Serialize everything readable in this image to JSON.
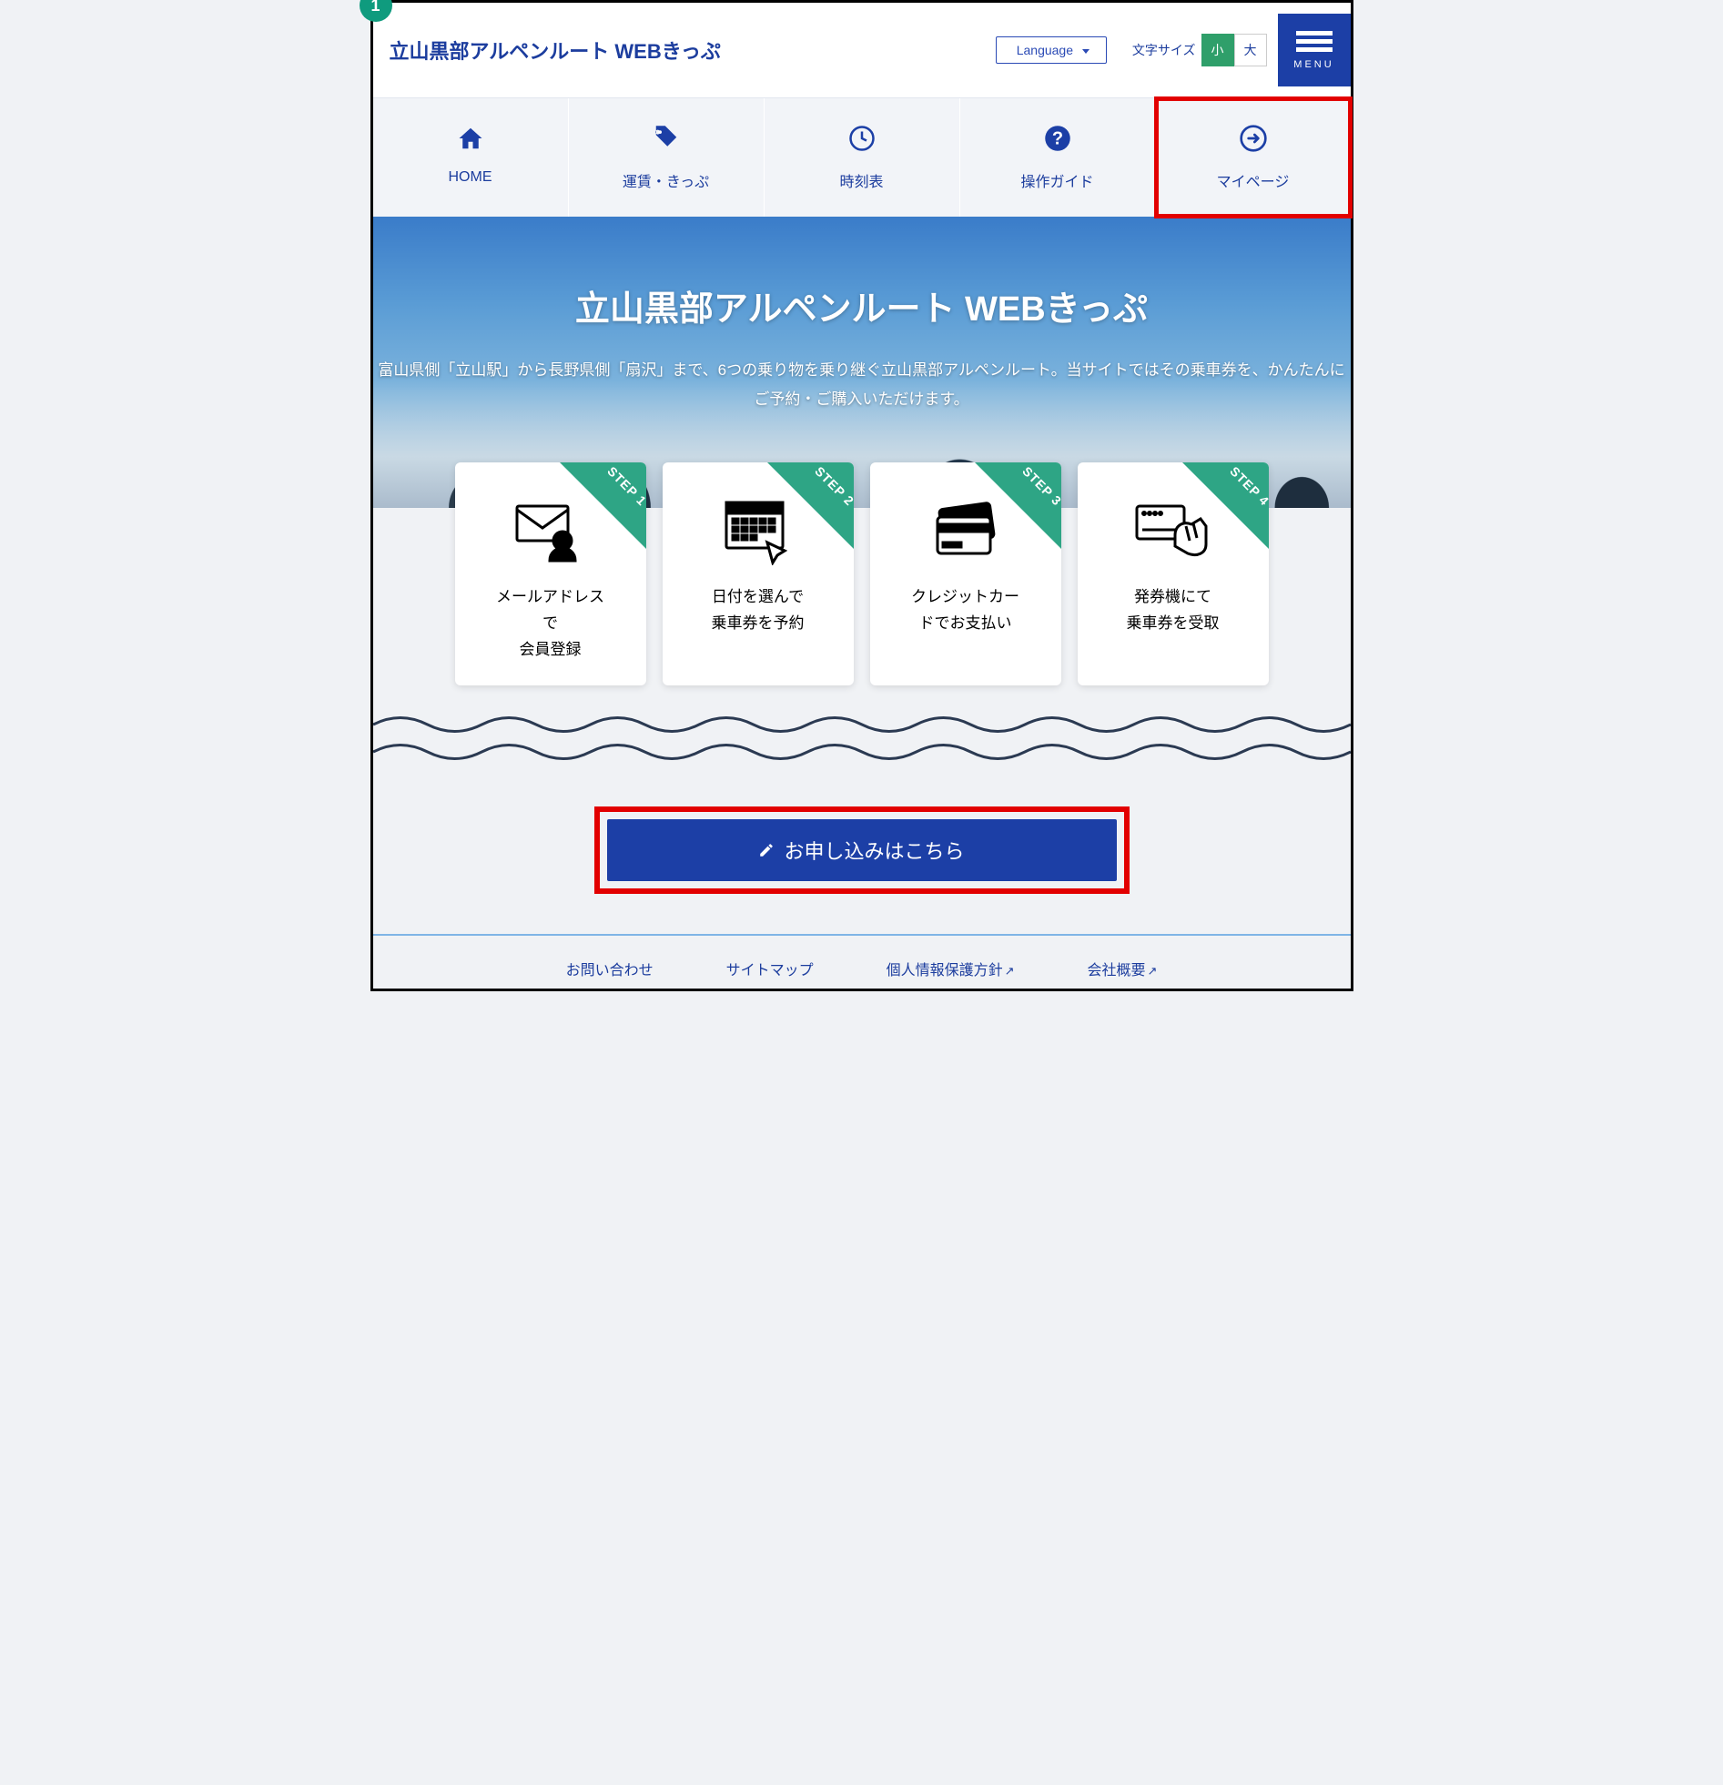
{
  "badge_number": "1",
  "header": {
    "brand": "立山黒部アルペンルート WEBきっぷ",
    "language_label": "Language",
    "font_size_label": "文字サイズ",
    "font_small": "小",
    "font_large": "大",
    "menu_label": "MENU"
  },
  "nav": [
    {
      "icon": "home-icon",
      "label": "HOME",
      "highlighted": false
    },
    {
      "icon": "tag-icon",
      "label": "運賃・きっぷ",
      "highlighted": false
    },
    {
      "icon": "clock-icon",
      "label": "時刻表",
      "highlighted": false
    },
    {
      "icon": "help-icon",
      "label": "操作ガイド",
      "highlighted": false
    },
    {
      "icon": "login-icon",
      "label": "マイページ",
      "highlighted": true
    }
  ],
  "hero": {
    "title": "立山黒部アルペンルート WEBきっぷ",
    "description": "富山県側「立山駅」から長野県側「扇沢」まで、6つの乗り物を乗り継ぐ立山黒部アルペンルート。当サイトではその乗車券を、かんたんにご予約・ご購入いただけます。"
  },
  "steps": [
    {
      "ribbon": "STEP 1",
      "title": "メールアドレス\nで\n会員登録"
    },
    {
      "ribbon": "STEP 2",
      "title": "日付を選んで\n乗車券を予約"
    },
    {
      "ribbon": "STEP 3",
      "title": "クレジットカー\nドでお支払い"
    },
    {
      "ribbon": "STEP 4",
      "title": "発券機にて\n乗車券を受取"
    }
  ],
  "cta": {
    "label": "お申し込みはこちら"
  },
  "footer": [
    {
      "label": "お問い合わせ",
      "external": false
    },
    {
      "label": "サイトマップ",
      "external": false
    },
    {
      "label": "個人情報保護方針",
      "external": true
    },
    {
      "label": "会社概要",
      "external": true
    }
  ]
}
